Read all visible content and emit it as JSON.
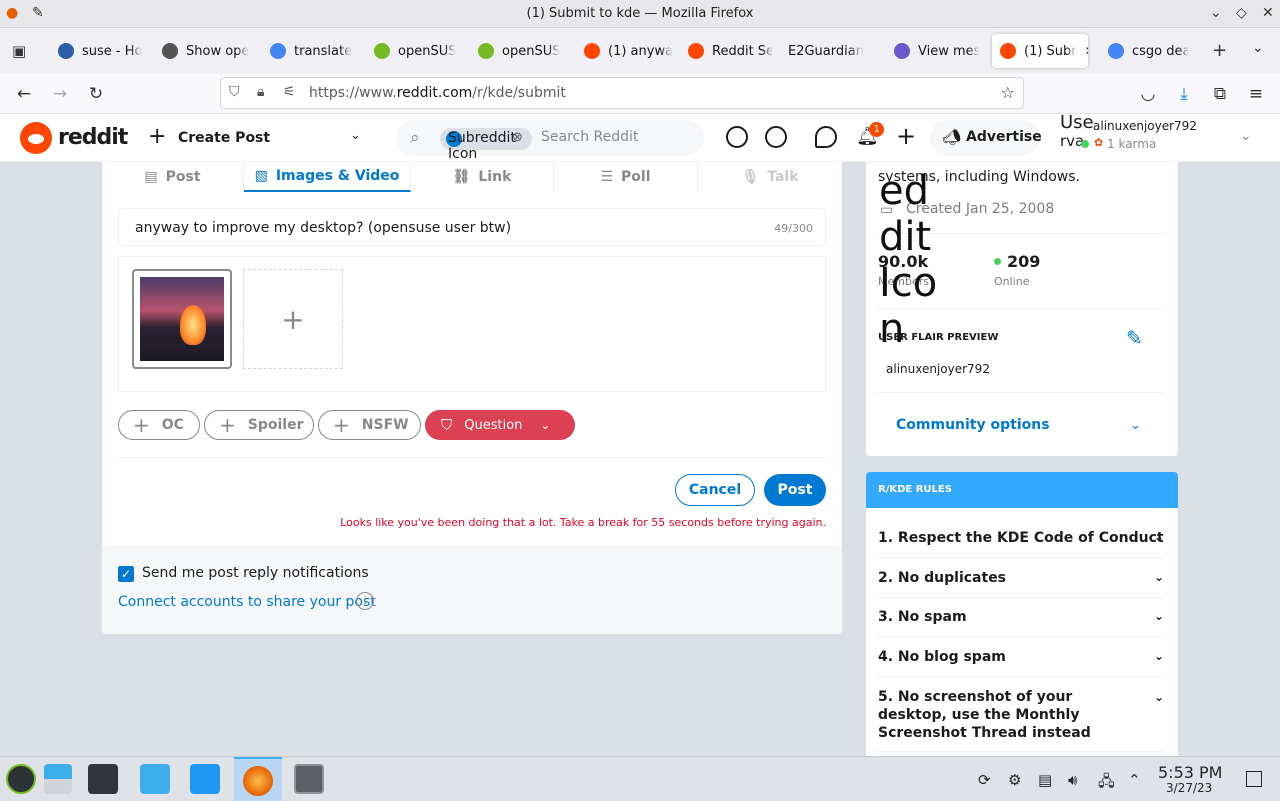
{
  "window": {
    "title": "(1) Submit to kde — Mozilla Firefox"
  },
  "tabs": [
    {
      "label": "suse - Ho",
      "color": "#2b5ea7"
    },
    {
      "label": "Show ope",
      "color": "#555555"
    },
    {
      "label": "translate",
      "color": "#4285f4"
    },
    {
      "label": "openSUS",
      "color": "#73ba25"
    },
    {
      "label": "openSUS",
      "color": "#73ba25"
    },
    {
      "label": "(1) anywa",
      "color": "#ff4500"
    },
    {
      "label": "Reddit Se",
      "color": "#ff4500"
    },
    {
      "label": "E2Guardian",
      "color": ""
    },
    {
      "label": "View mes",
      "color": "#6a5acd"
    },
    {
      "label": "(1) Subr",
      "color": "#ff4500"
    },
    {
      "label": "csgo dea",
      "color": "#4285f4"
    }
  ],
  "urlbar": {
    "prefix": "https://www.",
    "domain": "reddit.com",
    "path": "/r/kde/submit"
  },
  "reddit_header": {
    "brand": "reddit",
    "create_post": "Create Post",
    "subreddit_chip": "Subreddit Icon",
    "search_placeholder": "Search Reddit",
    "advertise": "Advertise",
    "notif_count": "1",
    "user_prefix": "Use",
    "user_prefix2": "rva",
    "username": "alinuxenjoyer792",
    "karma": "1 karma"
  },
  "post_tabs": [
    "Post",
    "Images & Video",
    "Link",
    "Poll",
    "Talk"
  ],
  "post": {
    "title": "anyway to improve my desktop? (opensuse user btw)",
    "count": "49/300",
    "tags": [
      "OC",
      "Spoiler",
      "NSFW"
    ],
    "flair": "Question",
    "cancel": "Cancel",
    "submit": "Post",
    "error": "Looks like you've been doing that a lot. Take a break for 55 seconds before trying again.",
    "notify_label": "Send me post reply notifications",
    "connect_label": "Connect accounts to share your post"
  },
  "about": {
    "desc": "systems, including Windows.",
    "created": "Created Jan 25, 2008",
    "members_value": "90.0k",
    "members_label": "Members",
    "online_value": "209",
    "online_label": "Online",
    "flair_heading": "USER FLAIR PREVIEW",
    "flair_user": "alinuxenjoyer792",
    "community_options": "Community options"
  },
  "overlay_text": "edditIcon",
  "rules": {
    "heading": "R/KDE RULES",
    "items": [
      "1. Respect the KDE Code of Conduct",
      "2. No duplicates",
      "3. No spam",
      "4. No blog spam",
      "5. No screenshot of your desktop, use the Monthly Screenshot Thread instead"
    ]
  },
  "taskbar": {
    "time": "5:53 PM",
    "date": "3/27/23"
  },
  "colors": {
    "accent": "#0079d3",
    "brand": "#ff4500",
    "flair": "#db4152",
    "rules_header": "#33a8ff"
  }
}
